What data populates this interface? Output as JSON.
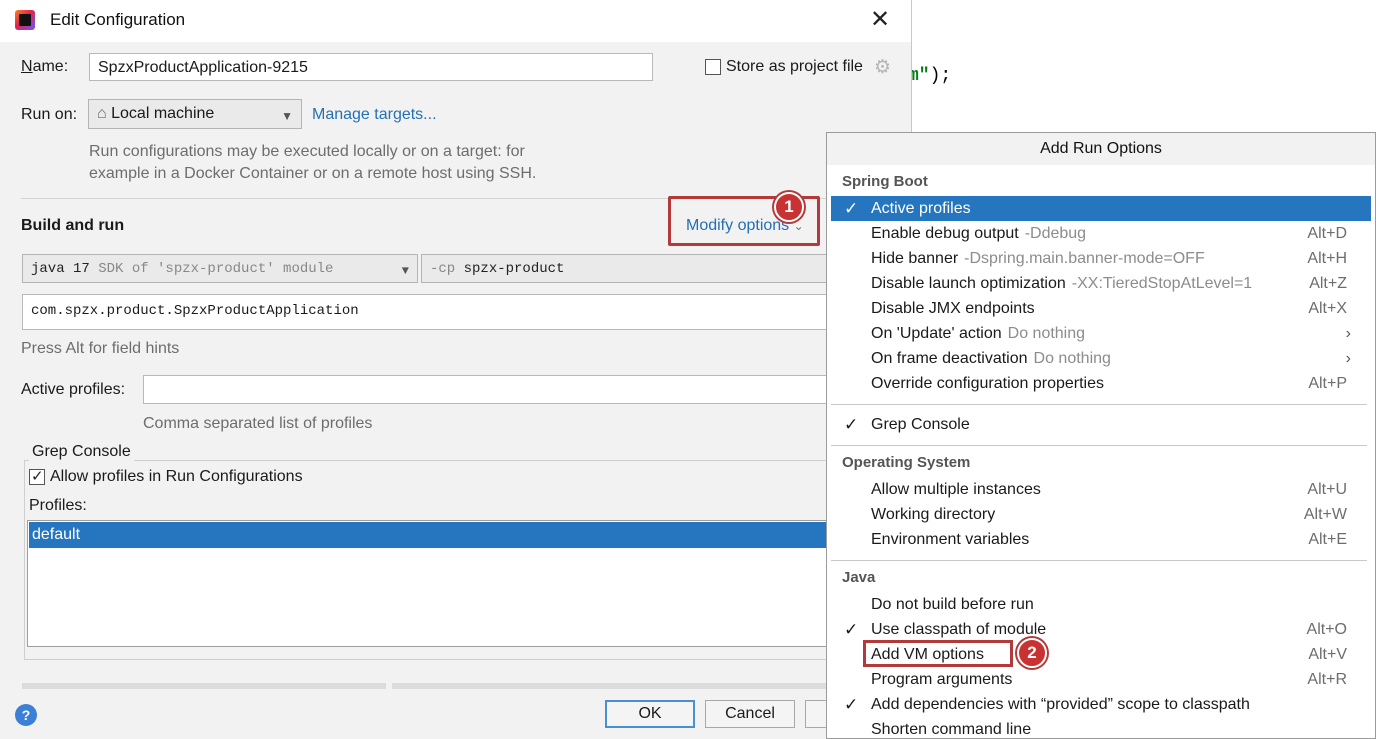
{
  "editor": {
    "code_string": "m\"",
    "code_rest": ");"
  },
  "dialog": {
    "title": "Edit Configuration",
    "name_label": "Name:",
    "name_value": "SpzxProductApplication-9215",
    "store_label": "Store as project file",
    "runon_label": "Run on:",
    "runon_value": "Local machine",
    "manage_targets": "Manage targets...",
    "runon_hint_1": "Run configurations may be executed locally or on a target: for",
    "runon_hint_2": "example in a Docker Container or on a remote host using SSH.",
    "build_title": "Build and run",
    "modify_options": "Modify options",
    "jdk_value": "java 17",
    "jdk_detail": "SDK of 'spzx-product' module",
    "cp_flag": "-cp",
    "cp_value": "spzx-product",
    "main_class": "com.spzx.product.SpzxProductApplication",
    "field_hint": "Press Alt for field hints",
    "active_profiles_label": "Active profiles:",
    "active_profiles_hint": "Comma separated list of profiles",
    "grep_title": "Grep Console",
    "allow_profiles": "Allow profiles in Run Configurations",
    "profiles_label": "Profiles:",
    "profiles": [
      "default"
    ],
    "ok": "OK",
    "cancel": "Cancel",
    "help": "?"
  },
  "badges": {
    "one": "1",
    "two": "2"
  },
  "popup": {
    "title": "Add Run Options",
    "sections": {
      "spring": "Spring Boot",
      "os": "Operating System",
      "java": "Java"
    },
    "spring_items": [
      {
        "name": "Active profiles",
        "extra": "",
        "shortcut": "",
        "checked": true
      },
      {
        "name": "Enable debug output",
        "extra": "-Ddebug",
        "shortcut": "Alt+D",
        "checked": false
      },
      {
        "name": "Hide banner",
        "extra": "-Dspring.main.banner-mode=OFF",
        "shortcut": "Alt+H",
        "checked": false
      },
      {
        "name": "Disable launch optimization",
        "extra": "-XX:TieredStopAtLevel=1",
        "shortcut": "Alt+Z",
        "checked": false
      },
      {
        "name": "Disable JMX endpoints",
        "extra": "",
        "shortcut": "Alt+X",
        "checked": false
      },
      {
        "name": "On 'Update' action",
        "extra": "Do nothing",
        "shortcut": "",
        "checked": false
      },
      {
        "name": "On frame deactivation",
        "extra": "Do nothing",
        "shortcut": "",
        "checked": false
      },
      {
        "name": "Override configuration properties",
        "extra": "",
        "shortcut": "Alt+P",
        "checked": false
      }
    ],
    "grep_item": "Grep Console",
    "os_items": [
      {
        "name": "Allow multiple instances",
        "shortcut": "Alt+U"
      },
      {
        "name": "Working directory",
        "shortcut": "Alt+W"
      },
      {
        "name": "Environment variables",
        "shortcut": "Alt+E"
      }
    ],
    "java_items": [
      {
        "name": "Do not build before run",
        "shortcut": "",
        "checked": false
      },
      {
        "name": "Use classpath of module",
        "shortcut": "Alt+O",
        "checked": true
      },
      {
        "name": "Add VM options",
        "shortcut": "Alt+V",
        "checked": false
      },
      {
        "name": "Program arguments",
        "shortcut": "Alt+R",
        "checked": false
      },
      {
        "name": "Add dependencies with “provided” scope to classpath",
        "shortcut": "",
        "checked": true
      },
      {
        "name": "Shorten command line",
        "shortcut": "",
        "checked": false
      }
    ],
    "check_glyph": "✓",
    "chevron_glyph": "›"
  },
  "colors": {
    "accent": "#2675bf",
    "link": "#2470b3",
    "annotation": "#b23a3a"
  }
}
